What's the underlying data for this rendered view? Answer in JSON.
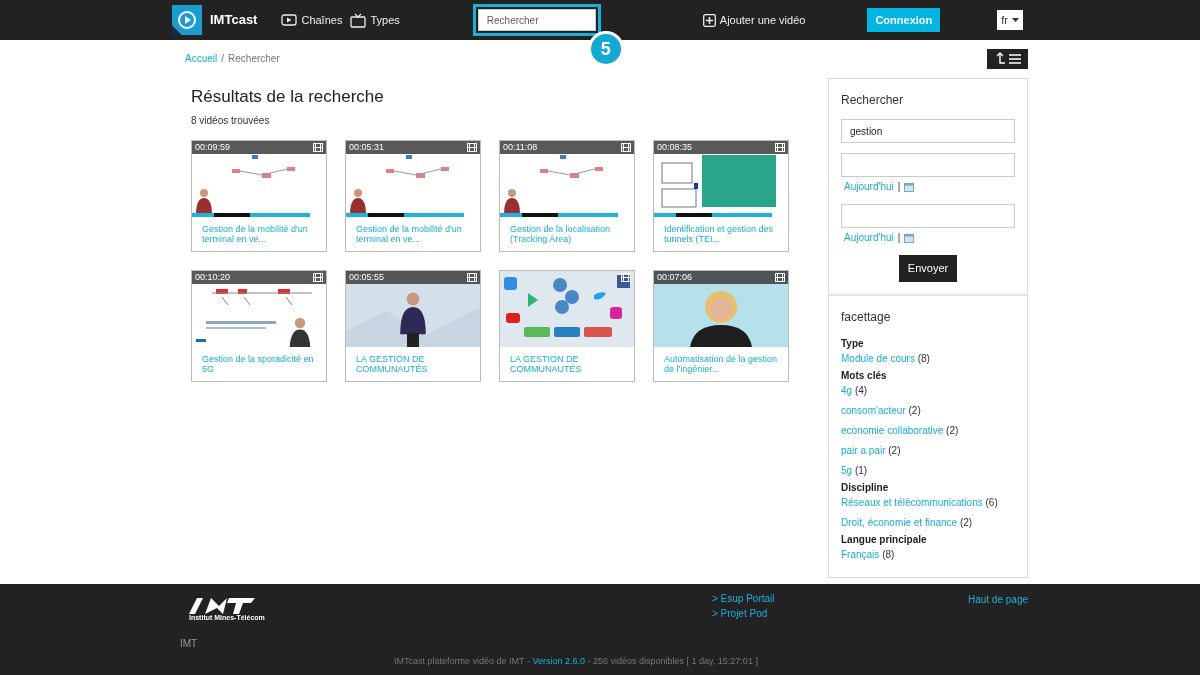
{
  "navbar": {
    "brand": "IMTcast",
    "links": [
      {
        "label": "Chaînes",
        "kind": "channels"
      },
      {
        "label": "Types",
        "kind": "types"
      }
    ],
    "search": {
      "placeholder": "Rechercher",
      "highlighted": true
    },
    "callout": "5",
    "add_video": "Ajouter une vidéo",
    "login": "Connexion",
    "language": "fr"
  },
  "breadcrumb": {
    "separator": "/",
    "items": [
      {
        "label": "Accueil",
        "link": true
      },
      {
        "label": "Rechercher",
        "link": false
      }
    ]
  },
  "results": {
    "title": "Résultats de la recherche",
    "count": "8 vidéos trouvées",
    "videos": [
      {
        "duration": "00:09:59",
        "title": "Gestion de la mobilité d'un terminal en ve...",
        "kind": "slides"
      },
      {
        "duration": "00:05:31",
        "title": "Gestion de la mobilité d'un terminal en ve...",
        "kind": "slides"
      },
      {
        "duration": "00:11:08",
        "title": "Gestion de la localisation (Tracking Area)",
        "kind": "slides"
      },
      {
        "duration": "00:08:35",
        "title": "Identification et gestion des tunnels (TEI...",
        "kind": "teal"
      },
      {
        "duration": "00:10:20",
        "title": "Gestion de la sporadicité en 5G",
        "kind": "lecture"
      },
      {
        "duration": "00:05:55",
        "title": "LA GESTION DE COMMUNAUTÉS",
        "kind": "studio"
      },
      {
        "title": "LA GESTION DE COMMUNAUTÉS",
        "kind": "apps"
      },
      {
        "duration": "00:07:06",
        "title": "Automatisation de la gestion de l'ingénier...",
        "kind": "portrait"
      }
    ]
  },
  "sidebar": {
    "search": {
      "title": "Rechercher",
      "query": "gestion",
      "dates": [
        {
          "today": "Aujourd'hui",
          "separator": "|"
        },
        {
          "today": "Aujourd'hui",
          "separator": "|"
        }
      ],
      "submit": "Envoyer"
    },
    "facets": {
      "title": "facettage",
      "groups": [
        {
          "name": "Type",
          "items": [
            {
              "label": "Module de cours",
              "count": "(8)"
            }
          ]
        },
        {
          "name": "Mots clés",
          "items": [
            {
              "label": "4g",
              "count": "(4)"
            },
            {
              "label": "consom'acteur",
              "count": "(2)"
            },
            {
              "label": "economie collaborative",
              "count": "(2)"
            },
            {
              "label": "pair a pair",
              "count": "(2)"
            },
            {
              "label": "5g",
              "count": "(1)"
            }
          ]
        },
        {
          "name": "Discipline",
          "items": [
            {
              "label": "Réseaux et télécommunications",
              "count": "(6)"
            },
            {
              "label": "Droit, économie et finance",
              "count": "(2)"
            }
          ]
        },
        {
          "name": "Langue principale",
          "items": [
            {
              "label": "Français",
              "count": "(8)"
            }
          ]
        }
      ]
    }
  },
  "footer": {
    "logo_caption": "Institut Mines-Télécom",
    "links": [
      "> Esup Portail",
      "> Projet Pod"
    ],
    "top_link": "Haut de page",
    "org": "IMT",
    "bottom": {
      "before": "IMTcast plateforme vidéo de IMT - ",
      "version": "Version 2.6.0",
      "after": " - 256 vidéos disponibles [ 1 day, 15:27:01 ]"
    }
  }
}
